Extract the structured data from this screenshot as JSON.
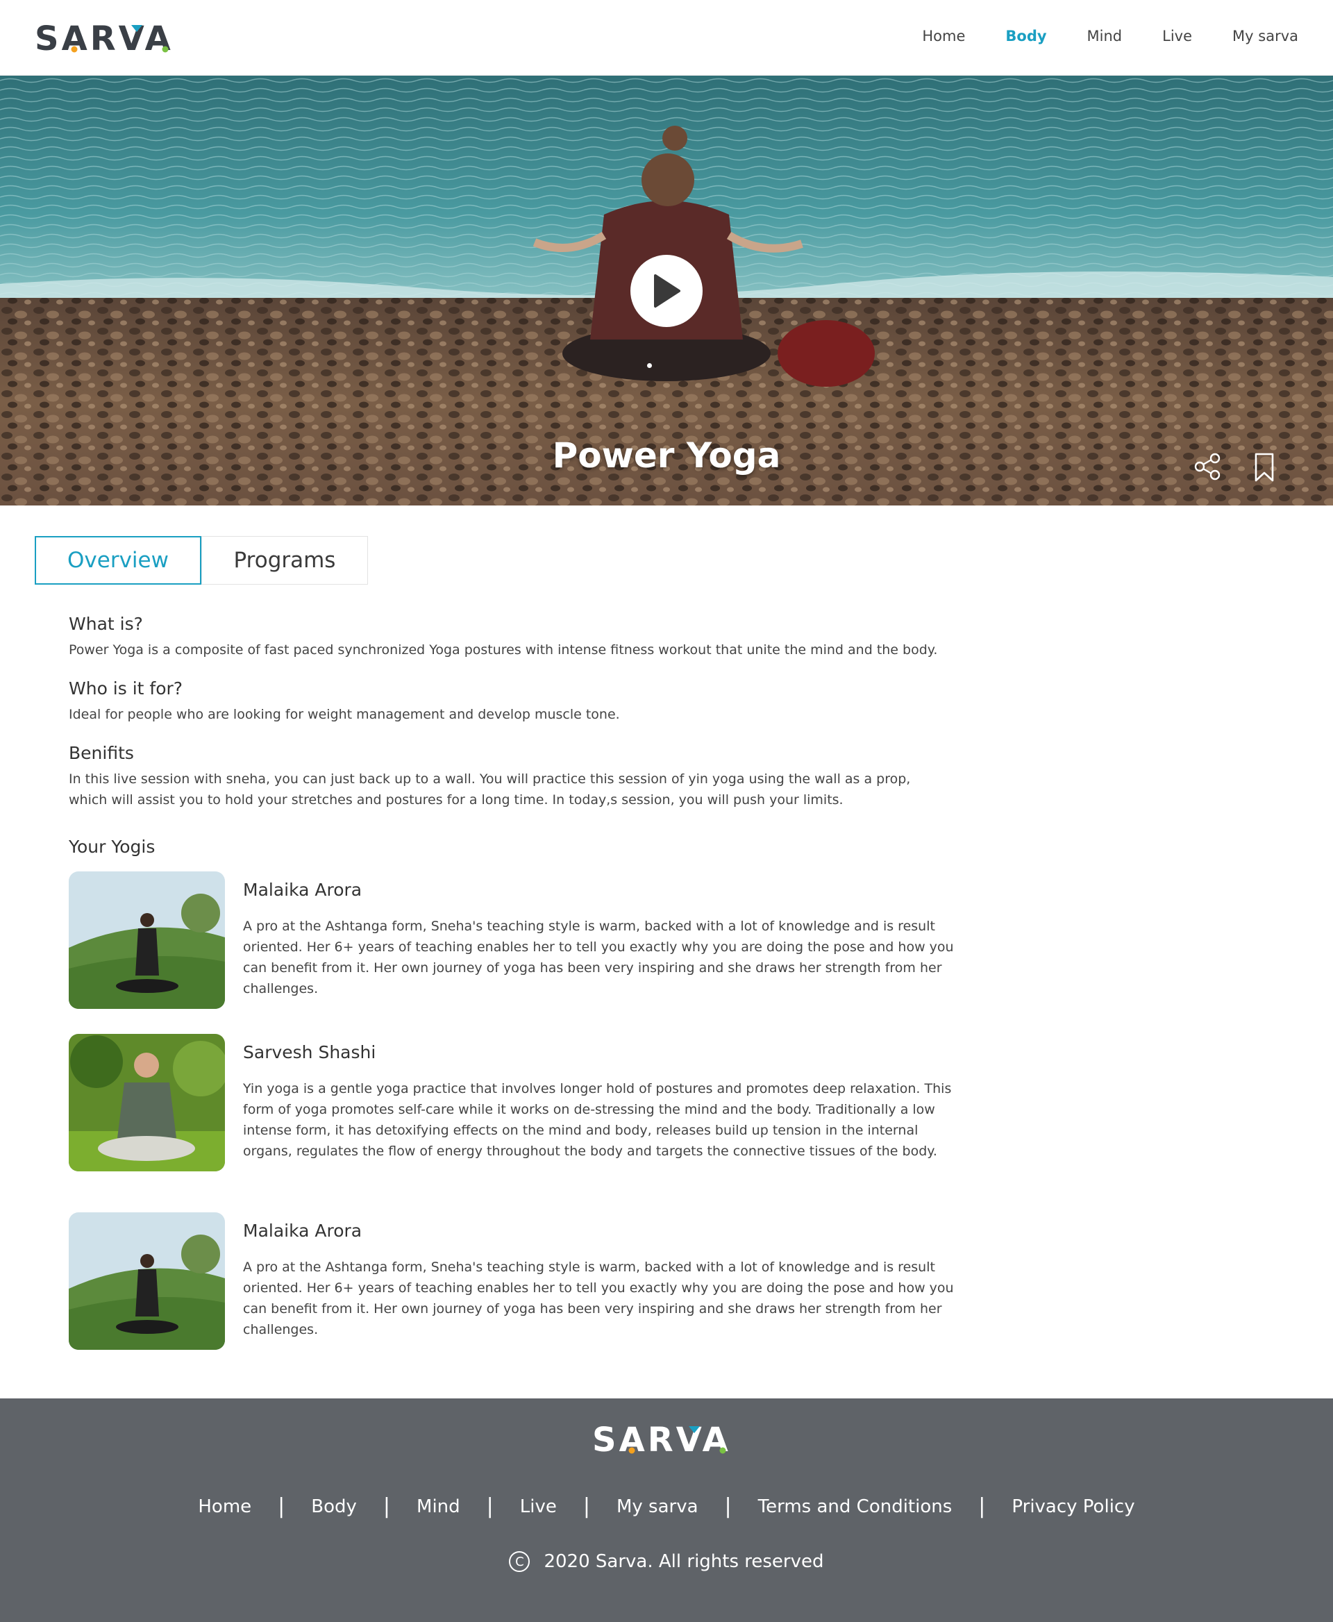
{
  "brand": {
    "name": "SARVA",
    "accent": "#1a9fc2"
  },
  "nav": {
    "items": [
      {
        "label": "Home",
        "active": false
      },
      {
        "label": "Body",
        "active": true
      },
      {
        "label": "Mind",
        "active": false
      },
      {
        "label": "Live",
        "active": false
      },
      {
        "label": "My sarva",
        "active": false
      }
    ]
  },
  "hero": {
    "title": "Power Yoga",
    "play_icon": "play-icon",
    "share_icon": "share-icon",
    "bookmark_icon": "bookmark-icon"
  },
  "tabs": [
    {
      "label": "Overview",
      "active": true
    },
    {
      "label": "Programs",
      "active": false
    }
  ],
  "overview": {
    "what_title": "What is?",
    "what_body": "Power Yoga is a composite of fast paced synchronized Yoga postures with intense fitness workout that unite the mind and the body.",
    "who_title": "Who is it for?",
    "who_body": "Ideal for people who are looking for weight management and develop muscle tone.",
    "benefits_title": "Benifits",
    "benefits_body": "In this live session with sneha, you can just back up to a wall. You will practice this session of yin yoga using the wall as a prop, which will assist you to hold your stretches and postures for a long time. In today,s session, you will push your limits."
  },
  "yogis": {
    "title": "Your Yogis",
    "items": [
      {
        "name": "Malaika Arora",
        "desc": "A pro at the Ashtanga form, Sneha's teaching style is warm, backed with a lot of knowledge and is result oriented. Her 6+ years of teaching enables her to tell you exactly why you are doing the pose and how you can benefit from it. Her own journey of yoga has been very inspiring and she draws her strength from her challenges."
      },
      {
        "name": "Sarvesh Shashi",
        "desc": "Yin yoga is a gentle yoga practice that involves longer hold of postures and promotes deep relaxation. This form of yoga promotes self-care while it works on de-stressing the mind and the body. Traditionally a low intense form, it has detoxifying effects on the mind and body, releases build up tension in the internal organs, regulates the flow of energy throughout the body and targets the connective tissues of the body."
      },
      {
        "name": "Malaika Arora",
        "desc": "A pro at the Ashtanga form, Sneha's teaching style is warm, backed with a lot of knowledge and is result oriented. Her 6+ years of teaching enables her to tell you exactly why you are doing the pose and how you can benefit from it. Her own journey of yoga has been very inspiring and she draws her strength from her challenges."
      }
    ]
  },
  "footer": {
    "brand": "SARVA",
    "links": [
      "Home",
      "Body",
      "Mind",
      "Live",
      "My sarva",
      "Terms and Conditions",
      "Privacy Policy"
    ],
    "copyright": "2020 Sarva. All rights reserved"
  }
}
